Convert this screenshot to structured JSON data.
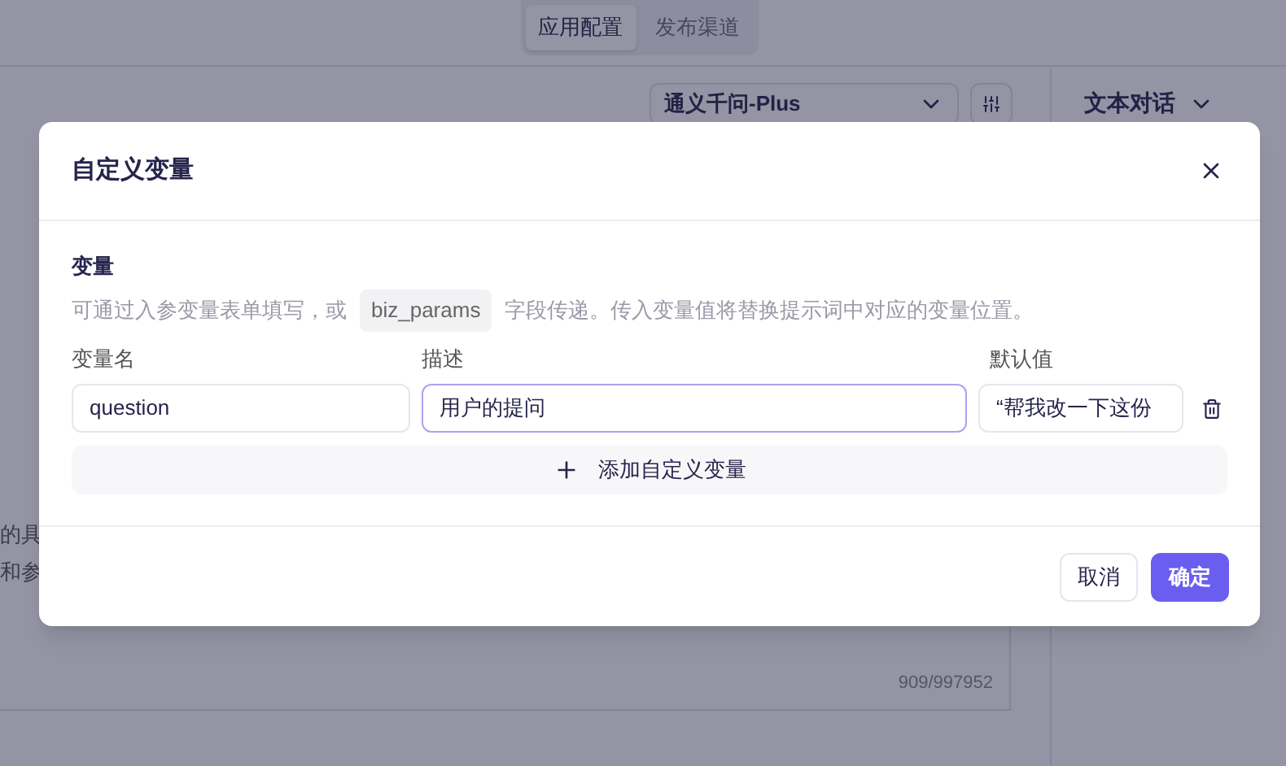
{
  "top_tabs": [
    {
      "label": "应用配置",
      "selected": true
    },
    {
      "label": "发布渠道",
      "selected": false
    }
  ],
  "model_select": {
    "value": "通义千问-Plus"
  },
  "mode_select": {
    "value": "文本对话"
  },
  "prompt_editor": {
    "lines": [
      "的具",
      "和参"
    ],
    "counter": "909/997952"
  },
  "dialog": {
    "title": "自定义变量",
    "section_title": "变量",
    "description_before": "可通过入参变量表单填写，或",
    "code": "biz_params",
    "description_after": "字段传递。传入变量值将替换提示词中对应的变量位置。",
    "columns": [
      "变量名",
      "描述",
      "默认值"
    ],
    "variables": [
      {
        "fields": [
          {
            "value": "question",
            "focused": false
          },
          {
            "value": "用户的提问",
            "focused": true
          },
          {
            "value": "“帮我改一下这份",
            "focused": false
          }
        ]
      }
    ],
    "add_button": "添加自定义变量",
    "buttons": [
      {
        "label": "取消",
        "kind": "secondary"
      },
      {
        "label": "确定",
        "kind": "primary"
      }
    ]
  }
}
